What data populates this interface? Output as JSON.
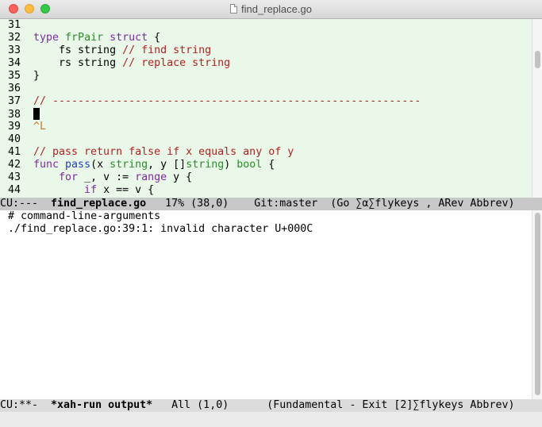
{
  "window": {
    "title": "find_replace.go"
  },
  "editor": {
    "lines": [
      {
        "num": "31",
        "segs": []
      },
      {
        "num": "32",
        "segs": [
          {
            "t": "type",
            "c": "kw"
          },
          {
            "t": " "
          },
          {
            "t": "frPair",
            "c": "tp"
          },
          {
            "t": " "
          },
          {
            "t": "struct",
            "c": "kw"
          },
          {
            "t": " {"
          }
        ]
      },
      {
        "num": "33",
        "segs": [
          {
            "t": "    fs string "
          },
          {
            "t": "// find string",
            "c": "cm"
          }
        ]
      },
      {
        "num": "34",
        "segs": [
          {
            "t": "    rs string "
          },
          {
            "t": "// replace string",
            "c": "cm"
          }
        ]
      },
      {
        "num": "35",
        "segs": [
          {
            "t": "}"
          }
        ]
      },
      {
        "num": "36",
        "segs": []
      },
      {
        "num": "37",
        "segs": [
          {
            "t": "// ----------------------------------------------------------",
            "c": "cm"
          }
        ]
      },
      {
        "num": "38",
        "segs": [],
        "cursor": true
      },
      {
        "num": "39",
        "segs": [
          {
            "t": "^L",
            "c": "ctl"
          }
        ]
      },
      {
        "num": "40",
        "segs": []
      },
      {
        "num": "41",
        "segs": [
          {
            "t": "// pass return false if x equals any of y",
            "c": "cm"
          }
        ]
      },
      {
        "num": "42",
        "segs": [
          {
            "t": "func",
            "c": "kw"
          },
          {
            "t": " "
          },
          {
            "t": "pass",
            "c": "fn"
          },
          {
            "t": "(x "
          },
          {
            "t": "string",
            "c": "tp"
          },
          {
            "t": ", y []"
          },
          {
            "t": "string",
            "c": "tp"
          },
          {
            "t": ") "
          },
          {
            "t": "bool",
            "c": "tp"
          },
          {
            "t": " {"
          }
        ]
      },
      {
        "num": "43",
        "segs": [
          {
            "t": "    "
          },
          {
            "t": "for",
            "c": "kw"
          },
          {
            "t": " _, v := "
          },
          {
            "t": "range",
            "c": "kw"
          },
          {
            "t": " y {"
          }
        ]
      },
      {
        "num": "44",
        "segs": [
          {
            "t": "        "
          },
          {
            "t": "if",
            "c": "kw"
          },
          {
            "t": " x == v {"
          }
        ]
      }
    ]
  },
  "modeline1": {
    "status": "CU:---  ",
    "buffer": "find_replace.go",
    "position": "   17% (38,0)",
    "vc": "    Git:master",
    "modes": "  (Go ∑α∑flykeys , ARev Abbrev)"
  },
  "output": {
    "lines": [
      "# command-line-arguments",
      "./find_replace.go:39:1: invalid character U+000C"
    ]
  },
  "modeline2": {
    "status": "CU:**-  ",
    "buffer": "*xah-run output*",
    "position": "   All (1,0)",
    "modes": "      (Fundamental - Exit [2]∑flykeys Abbrev)"
  }
}
